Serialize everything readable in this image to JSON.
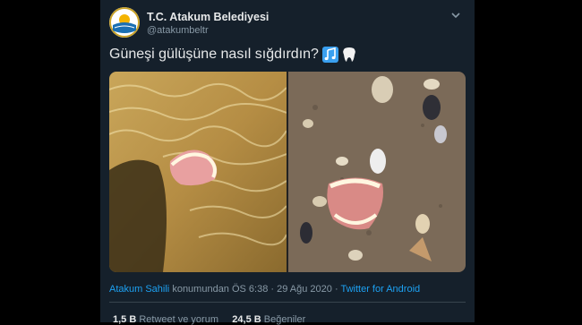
{
  "tweet": {
    "display_name": "T.C. Atakum Belediyesi",
    "handle": "@atakumbeltr",
    "text": "Güneşi gülüşüne nasıl sığdırdın?",
    "emojis": [
      "musical-notes-icon",
      "tooth-icon"
    ],
    "location": "Atakum Sahili",
    "location_suffix": " konumundan ÖS 6:38 · 29 Ağu 2020 · ",
    "source": "Twitter for Android"
  },
  "stats": {
    "retweet_count": "1,5 B",
    "retweet_label": " Retweet ve yorum",
    "like_count": "24,5 B",
    "like_label": " Beğeniler"
  },
  "colors": {
    "background": "#15202b",
    "accent": "#1da1f2",
    "muted": "#8899a6"
  }
}
